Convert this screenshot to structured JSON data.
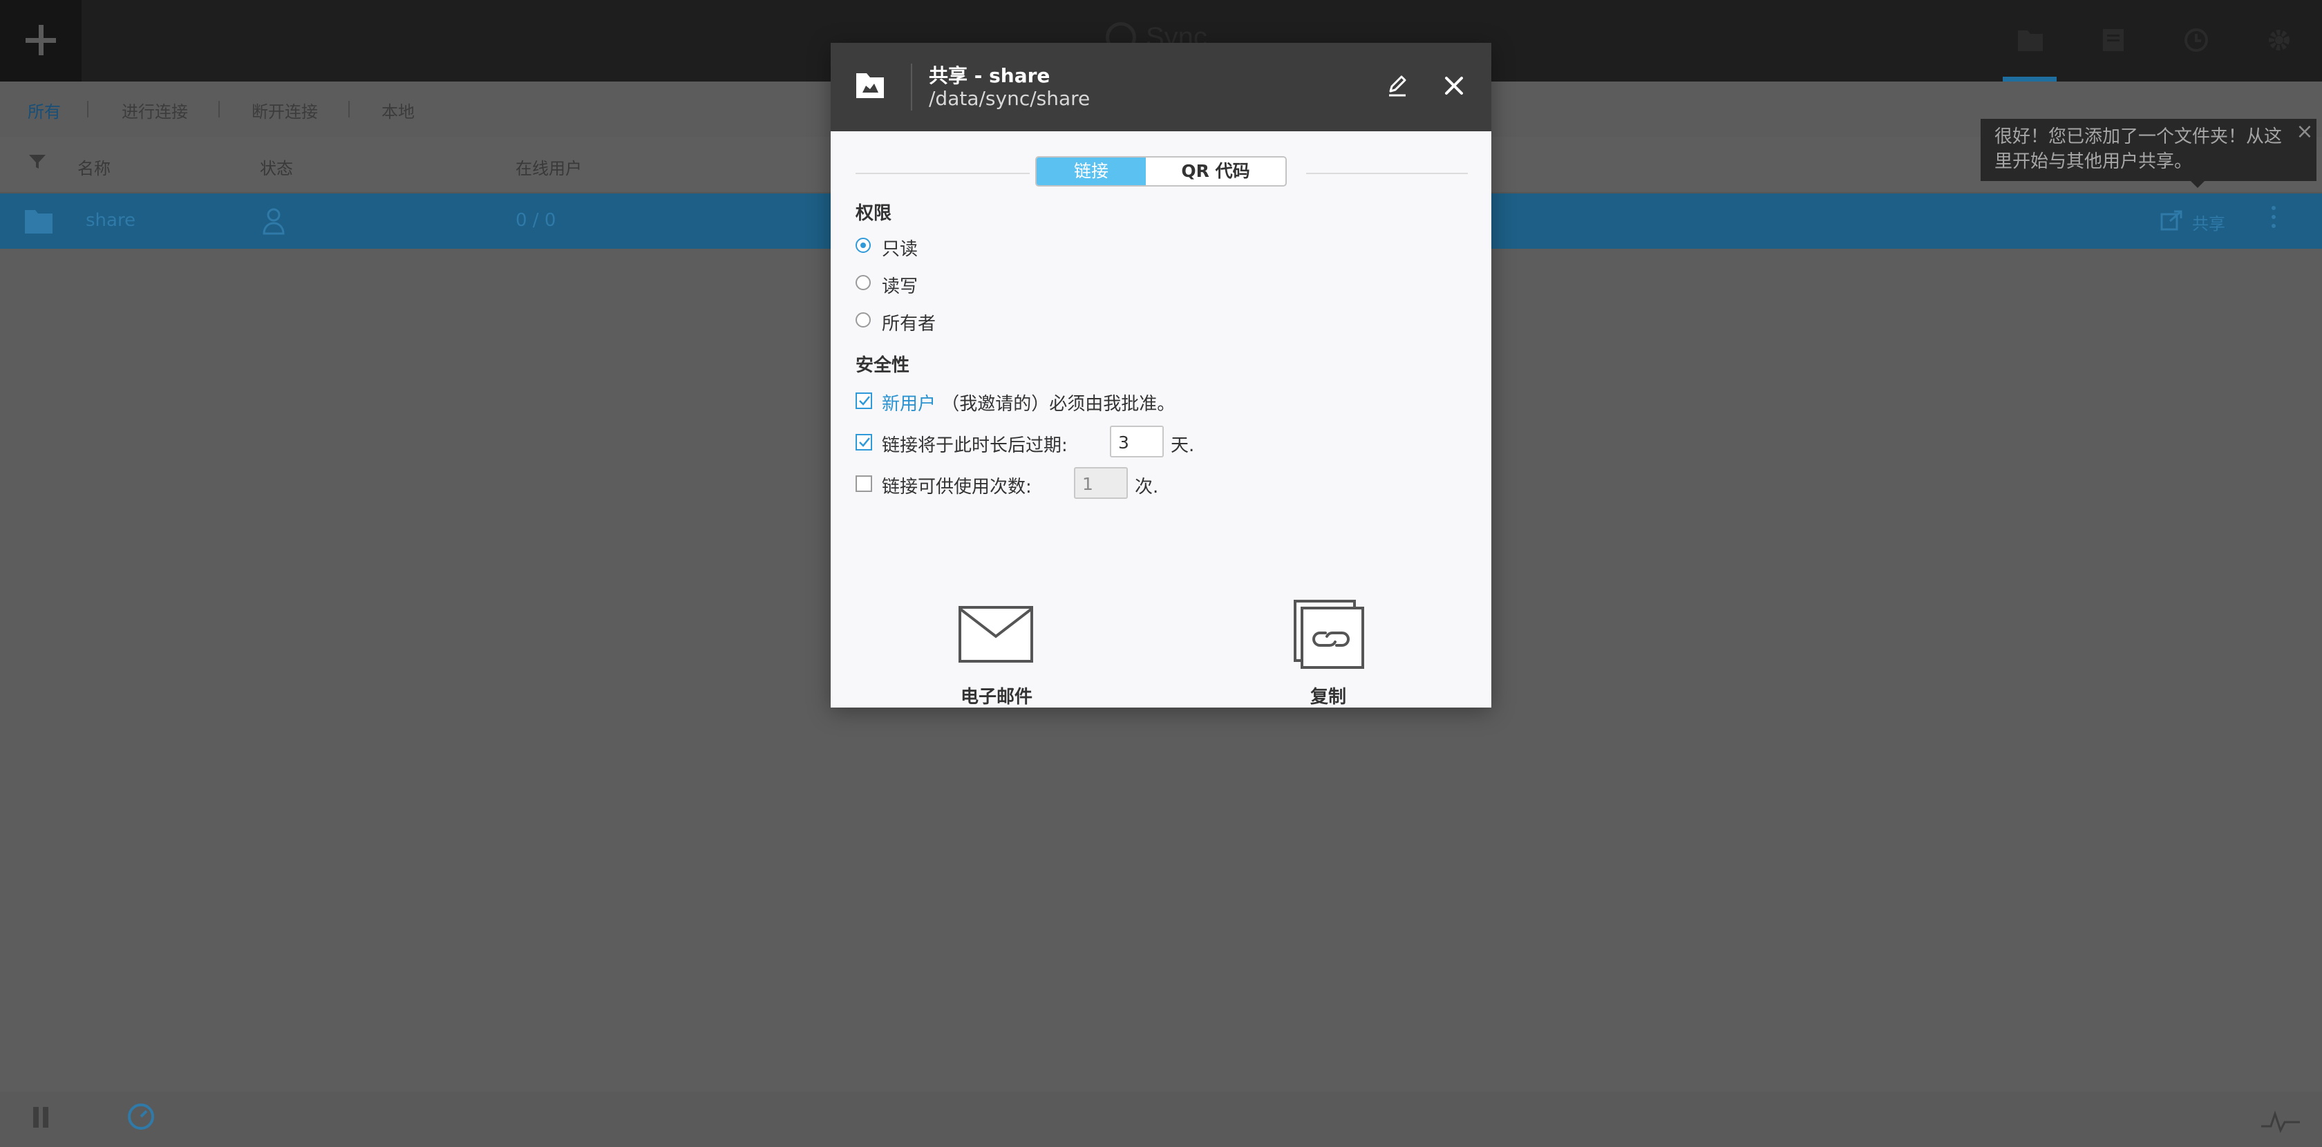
{
  "app": {
    "logo_text": "Sync",
    "filters": [
      "所有",
      "进行连接",
      "断开连接",
      "本地"
    ],
    "columns": {
      "name": "名称",
      "status": "状态",
      "peers": "在线用户"
    },
    "row": {
      "name": "share",
      "peers": "0 / 0",
      "share_label": "共享"
    }
  },
  "tooltip": {
    "text": "很好！您已添加了一个文件夹！从这里开始与其他用户共享。",
    "close": "×"
  },
  "modal": {
    "title": "共享 - share",
    "path": "/data/sync/share",
    "tabs": {
      "link": "链接",
      "qr": "QR 代码"
    },
    "permissions": {
      "heading": "权限",
      "options": [
        "只读",
        "读写",
        "所有者"
      ],
      "selected": "只读"
    },
    "security": {
      "heading": "安全性",
      "new_user_link": "新用户",
      "new_user_rest": "（我邀请的）必须由我批准。",
      "expire_label": "链接将于此时长后过期:",
      "expire_value": "3",
      "expire_unit": "天.",
      "uses_label": "链接可供使用次数:",
      "uses_value": "1",
      "uses_unit": "次."
    },
    "actions": {
      "email": "电子邮件",
      "copy": "复制"
    }
  },
  "colors": {
    "accent": "#5ac1f0",
    "link": "#2b93cf",
    "header": "#3d3d3d",
    "selected_row": "#1d5f86"
  }
}
